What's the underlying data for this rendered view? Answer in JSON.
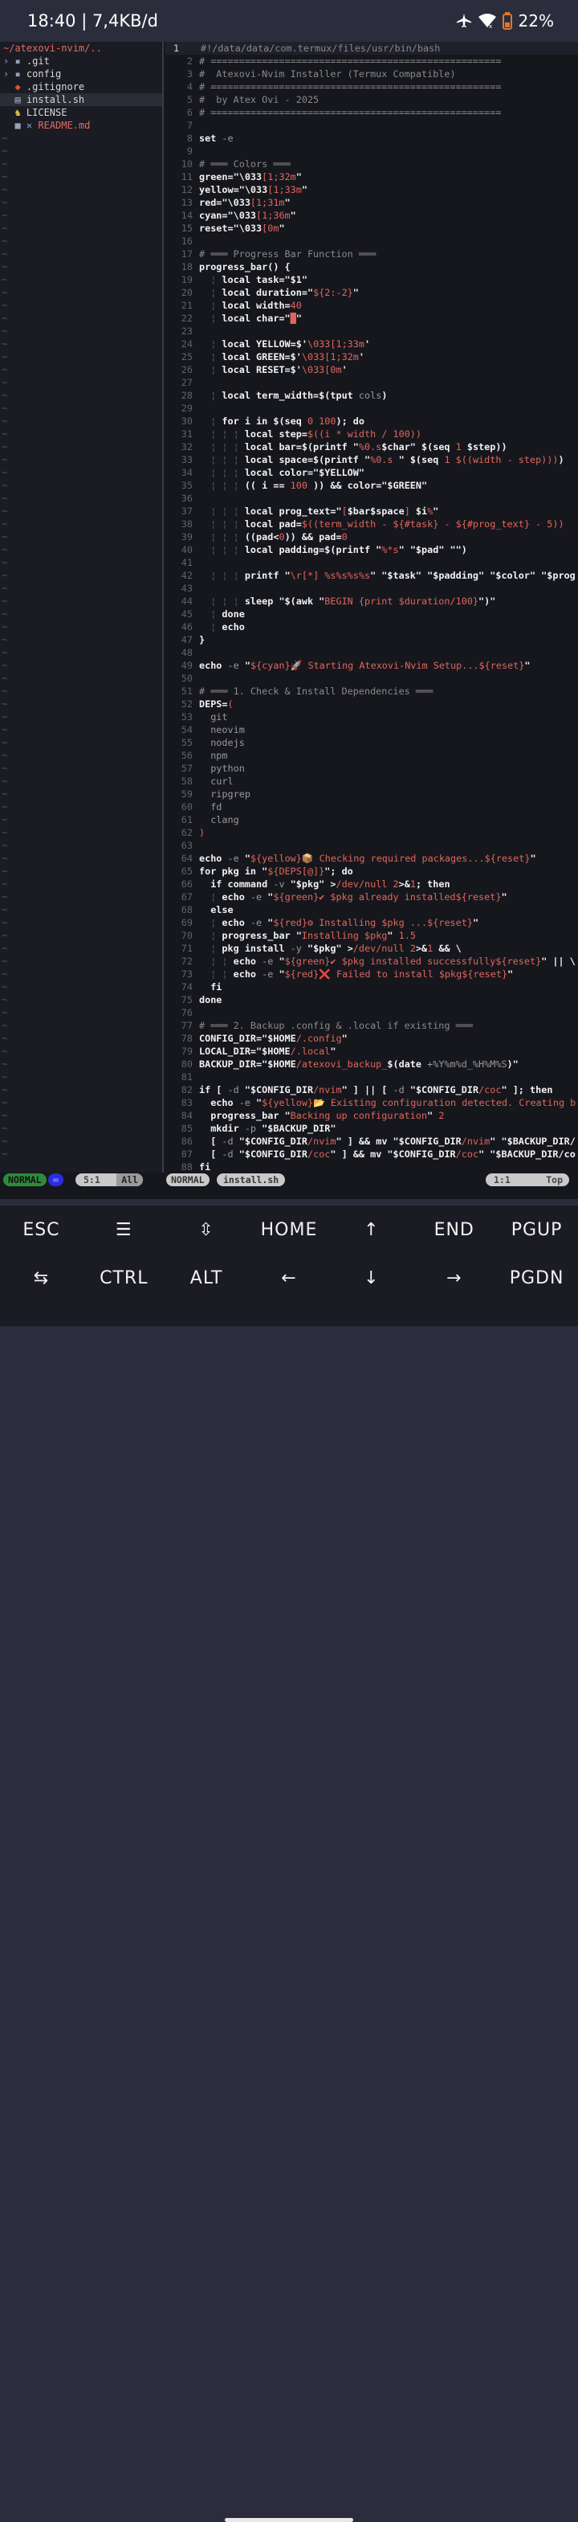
{
  "status_bar": {
    "time": "18:40 | 7,4KB/d",
    "battery": "22%"
  },
  "tree": {
    "root": "~/atexovi-nvim/..",
    "items": [
      {
        "arrow": "›",
        "icon": "▪",
        "name": ".git",
        "color": "#d8d8d8"
      },
      {
        "arrow": "›",
        "icon": "▪",
        "name": "config",
        "color": "#d8d8d8"
      },
      {
        "arrow": " ",
        "icon": "◆",
        "name": ".gitignore",
        "color": "#d8d8d8"
      },
      {
        "arrow": " ",
        "icon": "▤",
        "name": "install.sh",
        "color": "#d8d8d8"
      },
      {
        "arrow": " ",
        "icon": "♞",
        "name": "LICENSE",
        "color": "#d8d8d8"
      },
      {
        "arrow": " ",
        "icon": "■ ✕",
        "name": "README.md",
        "color": "#e06c60"
      }
    ]
  },
  "code_lines": [
    [
      [
        "#!/data/data/com.termux/files/usr/bin/bash",
        "c"
      ]
    ],
    [
      [
        "# ===================================================",
        "c"
      ]
    ],
    [
      [
        "#  Atexovi-Nvim Installer (Termux Compatible)",
        "c"
      ]
    ],
    [
      [
        "# ===================================================",
        "c"
      ]
    ],
    [
      [
        "#  by Atex Ovi - 2025",
        "c"
      ]
    ],
    [
      [
        "# ===================================================",
        "c"
      ]
    ],
    [],
    [
      [
        "set ",
        "k"
      ],
      [
        "-e",
        "n"
      ]
    ],
    [],
    [
      [
        "# ═══ Colors ═══",
        "c"
      ]
    ],
    [
      [
        "green=\"\\033",
        "k"
      ],
      [
        "[1;32m",
        "s"
      ],
      [
        "\"",
        "k"
      ]
    ],
    [
      [
        "yellow=\"\\033",
        "k"
      ],
      [
        "[1;33m",
        "s"
      ],
      [
        "\"",
        "k"
      ]
    ],
    [
      [
        "red=\"\\033",
        "k"
      ],
      [
        "[1;31m",
        "s"
      ],
      [
        "\"",
        "k"
      ]
    ],
    [
      [
        "cyan=\"\\033",
        "k"
      ],
      [
        "[1;36m",
        "s"
      ],
      [
        "\"",
        "k"
      ]
    ],
    [
      [
        "reset=\"\\033",
        "k"
      ],
      [
        "[0m",
        "s"
      ],
      [
        "\"",
        "k"
      ]
    ],
    [],
    [
      [
        "# ═══ Progress Bar Function ═══",
        "c"
      ]
    ],
    [
      [
        "progress_bar() {",
        "k"
      ]
    ],
    [
      [
        "  ¦ ",
        "g"
      ],
      [
        "local task=\"$1\"",
        "k"
      ]
    ],
    [
      [
        "  ¦ ",
        "g"
      ],
      [
        "local duration=\"",
        "k"
      ],
      [
        "${2:-2}",
        "s"
      ],
      [
        "\"",
        "k"
      ]
    ],
    [
      [
        "  ¦ ",
        "g"
      ],
      [
        "local width=",
        "k"
      ],
      [
        "40",
        "s"
      ]
    ],
    [
      [
        "  ¦ ",
        "g"
      ],
      [
        "local char=\"",
        "k"
      ],
      [
        "█",
        "s"
      ],
      [
        "\"",
        "k"
      ]
    ],
    [],
    [
      [
        "  ¦ ",
        "g"
      ],
      [
        "local YELLOW=$'",
        "k"
      ],
      [
        "\\033[1;33m",
        "s"
      ],
      [
        "'",
        "k"
      ]
    ],
    [
      [
        "  ¦ ",
        "g"
      ],
      [
        "local GREEN=$'",
        "k"
      ],
      [
        "\\033[1;32m",
        "s"
      ],
      [
        "'",
        "k"
      ]
    ],
    [
      [
        "  ¦ ",
        "g"
      ],
      [
        "local RESET=$'",
        "k"
      ],
      [
        "\\033[0m",
        "s"
      ],
      [
        "'",
        "k"
      ]
    ],
    [],
    [
      [
        "  ¦ ",
        "g"
      ],
      [
        "local term_width=$(tput ",
        "k"
      ],
      [
        "cols",
        "n"
      ],
      [
        ")",
        "k"
      ]
    ],
    [],
    [
      [
        "  ¦ ",
        "g"
      ],
      [
        "for i in $(seq ",
        "k"
      ],
      [
        "0 100",
        "s"
      ],
      [
        "); do",
        "k"
      ]
    ],
    [
      [
        "  ¦ ¦ ¦ ",
        "g"
      ],
      [
        "local step=",
        "k"
      ],
      [
        "$((i * width / 100))",
        "s"
      ]
    ],
    [
      [
        "  ¦ ¦ ¦ ",
        "g"
      ],
      [
        "local bar=$(printf \"",
        "k"
      ],
      [
        "%0.s",
        "s"
      ],
      [
        "$char\" $(seq ",
        "k"
      ],
      [
        "1",
        "s"
      ],
      [
        " $step))",
        "k"
      ]
    ],
    [
      [
        "  ¦ ¦ ¦ ",
        "g"
      ],
      [
        "local space=$(printf \"",
        "k"
      ],
      [
        "%0.s",
        "s"
      ],
      [
        " \" $(seq ",
        "k"
      ],
      [
        "1",
        "s"
      ],
      [
        " $((width - step)))",
        "s"
      ],
      [
        ")",
        "k"
      ]
    ],
    [
      [
        "  ¦ ¦ ¦ ",
        "g"
      ],
      [
        "local color=\"$YELLOW\"",
        "k"
      ]
    ],
    [
      [
        "  ¦ ¦ ¦ ",
        "g"
      ],
      [
        "(( i == ",
        "k"
      ],
      [
        "100",
        "s"
      ],
      [
        " )) && color=\"$GREEN\"",
        "k"
      ]
    ],
    [],
    [
      [
        "  ¦ ¦ ¦ ",
        "g"
      ],
      [
        "local prog_text=\"",
        "k"
      ],
      [
        "[",
        "s"
      ],
      [
        "$bar$space",
        "k"
      ],
      [
        "]",
        "s"
      ],
      [
        " $i",
        "k"
      ],
      [
        "%",
        "s"
      ],
      [
        "\"",
        "k"
      ]
    ],
    [
      [
        "  ¦ ¦ ¦ ",
        "g"
      ],
      [
        "local pad=",
        "k"
      ],
      [
        "$((term_width - ${#task} - ${#prog_text} - 5))",
        "s"
      ]
    ],
    [
      [
        "  ¦ ¦ ¦ ",
        "g"
      ],
      [
        "((pad<",
        "k"
      ],
      [
        "0",
        "s"
      ],
      [
        ")) && pad=",
        "k"
      ],
      [
        "0",
        "s"
      ]
    ],
    [
      [
        "  ¦ ¦ ¦ ",
        "g"
      ],
      [
        "local padding=$(printf \"",
        "k"
      ],
      [
        "%*s",
        "s"
      ],
      [
        "\" \"$pad\" \"\")",
        "k"
      ]
    ],
    [],
    [
      [
        "  ¦ ¦ ¦ ",
        "g"
      ],
      [
        "printf \"",
        "k"
      ],
      [
        "\\r[*] %s%s%s%s",
        "s"
      ],
      [
        "\" \"$task\" \"$padding\" \"$color\" \"$prog",
        "k"
      ]
    ],
    [],
    [
      [
        "  ¦ ¦ ¦ ",
        "g"
      ],
      [
        "sleep \"$(awk \"",
        "k"
      ],
      [
        "BEGIN {print $duration/100}",
        "s"
      ],
      [
        "\")\"",
        "k"
      ]
    ],
    [
      [
        "  ¦ ",
        "g"
      ],
      [
        "done",
        "k"
      ]
    ],
    [
      [
        "  ¦ ",
        "g"
      ],
      [
        "echo",
        "k"
      ]
    ],
    [
      [
        "}",
        "k"
      ]
    ],
    [],
    [
      [
        "echo ",
        "k"
      ],
      [
        "-e",
        "n"
      ],
      [
        " \"",
        "k"
      ],
      [
        "${cyan}🚀 Starting Atexovi-Nvim Setup...${reset}",
        "s"
      ],
      [
        "\"",
        "k"
      ]
    ],
    [],
    [
      [
        "# ═══ 1. Check & Install Dependencies ═══",
        "c"
      ]
    ],
    [
      [
        "DEPS=",
        "k"
      ],
      [
        "(",
        "s"
      ]
    ],
    [
      [
        "  git",
        "n"
      ]
    ],
    [
      [
        "  neovim",
        "n"
      ]
    ],
    [
      [
        "  nodejs",
        "n"
      ]
    ],
    [
      [
        "  npm",
        "n"
      ]
    ],
    [
      [
        "  python",
        "n"
      ]
    ],
    [
      [
        "  curl",
        "n"
      ]
    ],
    [
      [
        "  ripgrep",
        "n"
      ]
    ],
    [
      [
        "  fd",
        "n"
      ]
    ],
    [
      [
        "  clang",
        "n"
      ]
    ],
    [
      [
        ")",
        "s"
      ]
    ],
    [],
    [
      [
        "echo ",
        "k"
      ],
      [
        "-e",
        "n"
      ],
      [
        " \"",
        "k"
      ],
      [
        "${yellow}📦 Checking required packages...${reset}",
        "s"
      ],
      [
        "\"",
        "k"
      ]
    ],
    [
      [
        "for pkg in \"",
        "k"
      ],
      [
        "${DEPS[@]}",
        "s"
      ],
      [
        "\"; do",
        "k"
      ]
    ],
    [
      [
        "  if command ",
        "k"
      ],
      [
        "-v",
        "n"
      ],
      [
        " \"$pkg\" >",
        "k"
      ],
      [
        "/dev/null 2",
        "s"
      ],
      [
        ">&",
        "k"
      ],
      [
        "1",
        "s"
      ],
      [
        "; then",
        "k"
      ]
    ],
    [
      [
        "  ¦ ",
        "g"
      ],
      [
        "echo ",
        "k"
      ],
      [
        "-e",
        "n"
      ],
      [
        " \"",
        "k"
      ],
      [
        "${green}✔ $pkg already installed${reset}",
        "s"
      ],
      [
        "\"",
        "k"
      ]
    ],
    [
      [
        "  else",
        "k"
      ]
    ],
    [
      [
        "  ¦ ",
        "g"
      ],
      [
        "echo ",
        "k"
      ],
      [
        "-e",
        "n"
      ],
      [
        " \"",
        "k"
      ],
      [
        "${red}⚙ Installing $pkg ...${reset}",
        "s"
      ],
      [
        "\"",
        "k"
      ]
    ],
    [
      [
        "  ¦ ",
        "g"
      ],
      [
        "progress_bar \"",
        "k"
      ],
      [
        "Installing $pkg",
        "s"
      ],
      [
        "\" ",
        "k"
      ],
      [
        "1.5",
        "s"
      ]
    ],
    [
      [
        "  ¦ ",
        "g"
      ],
      [
        "pkg install ",
        "k"
      ],
      [
        "-y",
        "n"
      ],
      [
        " \"$pkg\" >",
        "k"
      ],
      [
        "/dev/null 2",
        "s"
      ],
      [
        ">&",
        "k"
      ],
      [
        "1",
        "s"
      ],
      [
        " && \\",
        "k"
      ]
    ],
    [
      [
        "  ¦ ¦ ",
        "g"
      ],
      [
        "echo ",
        "k"
      ],
      [
        "-e",
        "n"
      ],
      [
        " \"",
        "k"
      ],
      [
        "${green}✔ $pkg installed successfully${reset}",
        "s"
      ],
      [
        "\" || \\",
        "k"
      ]
    ],
    [
      [
        "  ¦ ¦ ",
        "g"
      ],
      [
        "echo ",
        "k"
      ],
      [
        "-e",
        "n"
      ],
      [
        " \"",
        "k"
      ],
      [
        "${red}❌ Failed to install $pkg${reset}",
        "s"
      ],
      [
        "\"",
        "k"
      ]
    ],
    [
      [
        "  fi",
        "k"
      ]
    ],
    [
      [
        "done",
        "k"
      ]
    ],
    [],
    [
      [
        "# ═══ 2. Backup .config & .local if existing ═══",
        "c"
      ]
    ],
    [
      [
        "CONFIG_DIR=\"$HOME",
        "k"
      ],
      [
        "/.config",
        "s"
      ],
      [
        "\"",
        "k"
      ]
    ],
    [
      [
        "LOCAL_DIR=\"$HOME",
        "k"
      ],
      [
        "/.local",
        "s"
      ],
      [
        "\"",
        "k"
      ]
    ],
    [
      [
        "BACKUP_DIR=\"$HOME",
        "k"
      ],
      [
        "/atexovi_backup_",
        "s"
      ],
      [
        "$(date ",
        "k"
      ],
      [
        "+%Y%m%d_%H%M%S",
        "n"
      ],
      [
        ")\"",
        "k"
      ]
    ],
    [],
    [
      [
        "if [ ",
        "k"
      ],
      [
        "-d",
        "n"
      ],
      [
        " \"$CONFIG_DIR",
        "k"
      ],
      [
        "/nvim",
        "s"
      ],
      [
        "\" ] || [ ",
        "k"
      ],
      [
        "-d",
        "n"
      ],
      [
        " \"$CONFIG_DIR",
        "k"
      ],
      [
        "/coc",
        "s"
      ],
      [
        "\" ]; then",
        "k"
      ]
    ],
    [
      [
        "  echo ",
        "k"
      ],
      [
        "-e",
        "n"
      ],
      [
        " \"",
        "k"
      ],
      [
        "${yellow}📂 Existing configuration detected. Creating b",
        "s"
      ]
    ],
    [
      [
        "  progress_bar \"",
        "k"
      ],
      [
        "Backing up configuration",
        "s"
      ],
      [
        "\" ",
        "k"
      ],
      [
        "2",
        "s"
      ]
    ],
    [
      [
        "  mkdir ",
        "k"
      ],
      [
        "-p",
        "n"
      ],
      [
        " \"$BACKUP_DIR\"",
        "k"
      ]
    ],
    [
      [
        "  [ ",
        "k"
      ],
      [
        "-d",
        "n"
      ],
      [
        " \"$CONFIG_DIR",
        "k"
      ],
      [
        "/nvim",
        "s"
      ],
      [
        "\" ] && mv \"$CONFIG_DIR",
        "k"
      ],
      [
        "/nvim",
        "s"
      ],
      [
        "\" \"$BACKUP_DIR/",
        "k"
      ]
    ],
    [
      [
        "  [ ",
        "k"
      ],
      [
        "-d",
        "n"
      ],
      [
        " \"$CONFIG_DIR",
        "k"
      ],
      [
        "/coc",
        "s"
      ],
      [
        "\" ] && mv \"$CONFIG_DIR",
        "k"
      ],
      [
        "/coc",
        "s"
      ],
      [
        "\" \"$BACKUP_DIR/co",
        "k"
      ]
    ],
    [
      [
        "fi",
        "k"
      ]
    ]
  ],
  "statusline": {
    "left_mode": "NORMAL",
    "left_icon": "∞",
    "left_pos": "5:1",
    "left_scroll": "All",
    "right_mode": "NORMAL",
    "filename": "install.sh",
    "right_pos": "1:1",
    "right_scroll": "Top"
  },
  "extra_keys": {
    "row1": [
      "ESC",
      "☰",
      "⇳",
      "HOME",
      "↑",
      "END",
      "PGUP"
    ],
    "row2": [
      "⇆",
      "CTRL",
      "ALT",
      "←",
      "↓",
      "→",
      "PGDN"
    ]
  },
  "colors": {
    "comment": "#8a8a8a",
    "keyword": "#f2f2f2",
    "string": "#e0665c",
    "number": "#9a9a9a",
    "guide": "#5a5d6a",
    "mode_green": "#2e8b3a",
    "mode_blue": "#2c2ce0",
    "pill_gray": "#c9c9c9"
  }
}
